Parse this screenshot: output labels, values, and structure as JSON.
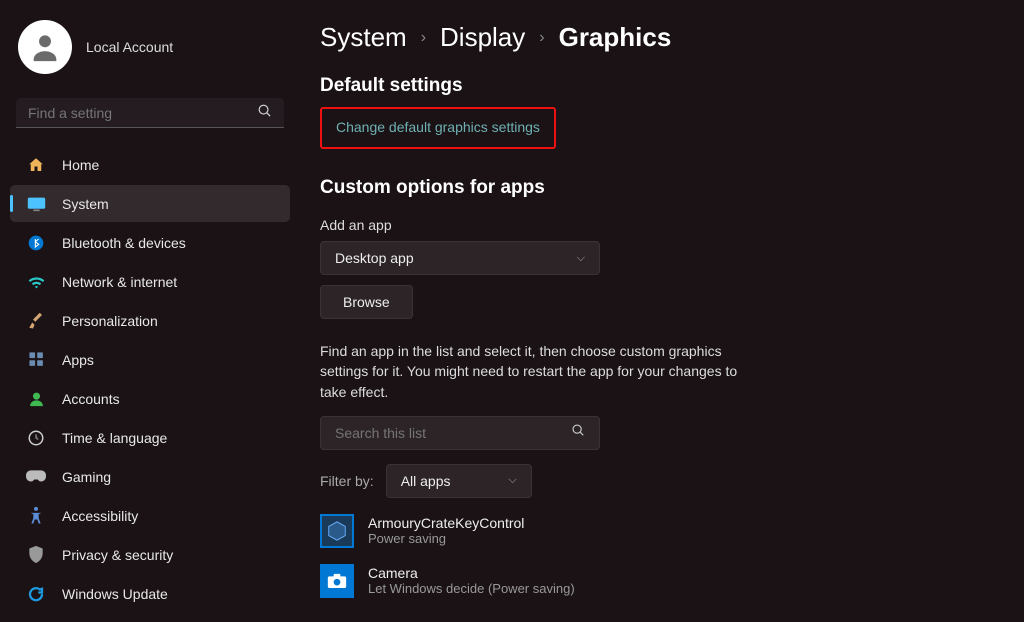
{
  "account": {
    "name": "Local Account"
  },
  "search": {
    "placeholder": "Find a setting"
  },
  "nav": [
    {
      "label": "Home",
      "icon": "home"
    },
    {
      "label": "System",
      "icon": "system",
      "selected": true
    },
    {
      "label": "Bluetooth & devices",
      "icon": "bluetooth"
    },
    {
      "label": "Network & internet",
      "icon": "wifi"
    },
    {
      "label": "Personalization",
      "icon": "brush"
    },
    {
      "label": "Apps",
      "icon": "apps"
    },
    {
      "label": "Accounts",
      "icon": "person"
    },
    {
      "label": "Time & language",
      "icon": "clock"
    },
    {
      "label": "Gaming",
      "icon": "gaming"
    },
    {
      "label": "Accessibility",
      "icon": "accessibility"
    },
    {
      "label": "Privacy & security",
      "icon": "shield"
    },
    {
      "label": "Windows Update",
      "icon": "update"
    }
  ],
  "breadcrumb": [
    "System",
    "Display",
    "Graphics"
  ],
  "section1": {
    "title": "Default settings",
    "link": "Change default graphics settings"
  },
  "section2": {
    "title": "Custom options for apps",
    "add_label": "Add an app",
    "app_type": "Desktop app",
    "browse": "Browse",
    "help": "Find an app in the list and select it, then choose custom graphics settings for it. You might need to restart the app for your changes to take effect.",
    "search_placeholder": "Search this list",
    "filter_label": "Filter by:",
    "filter_value": "All apps",
    "apps": [
      {
        "name": "ArmouryCrateKeyControl",
        "sub": "Power saving"
      },
      {
        "name": "Camera",
        "sub": "Let Windows decide (Power saving)"
      }
    ]
  }
}
